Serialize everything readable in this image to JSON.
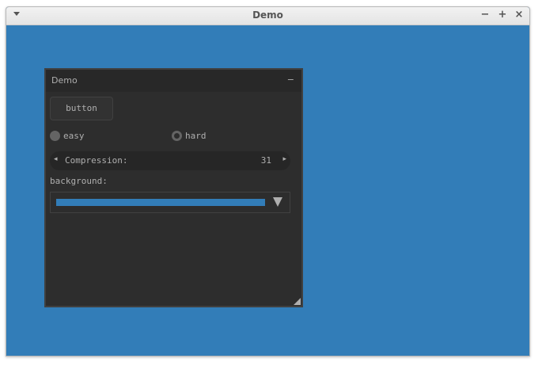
{
  "window": {
    "title": "Demo",
    "menu_icon": "chevron-down-icon",
    "controls": {
      "minimize": "−",
      "maximize": "+",
      "close": "×"
    },
    "background_color": "#327db8"
  },
  "panel": {
    "title": "Demo",
    "minimize_symbol": "−",
    "button_label": "button",
    "radio": {
      "options": [
        "easy",
        "hard"
      ],
      "selected": "easy"
    },
    "property": {
      "label": "Compression:",
      "value": "31",
      "left_arrow": "◂",
      "right_arrow": "▸"
    },
    "background_label": "background:",
    "background_color": "#327db8",
    "colors": {
      "panel": "#2d2d2d",
      "header": "#282828",
      "text": "#afafaf"
    }
  }
}
